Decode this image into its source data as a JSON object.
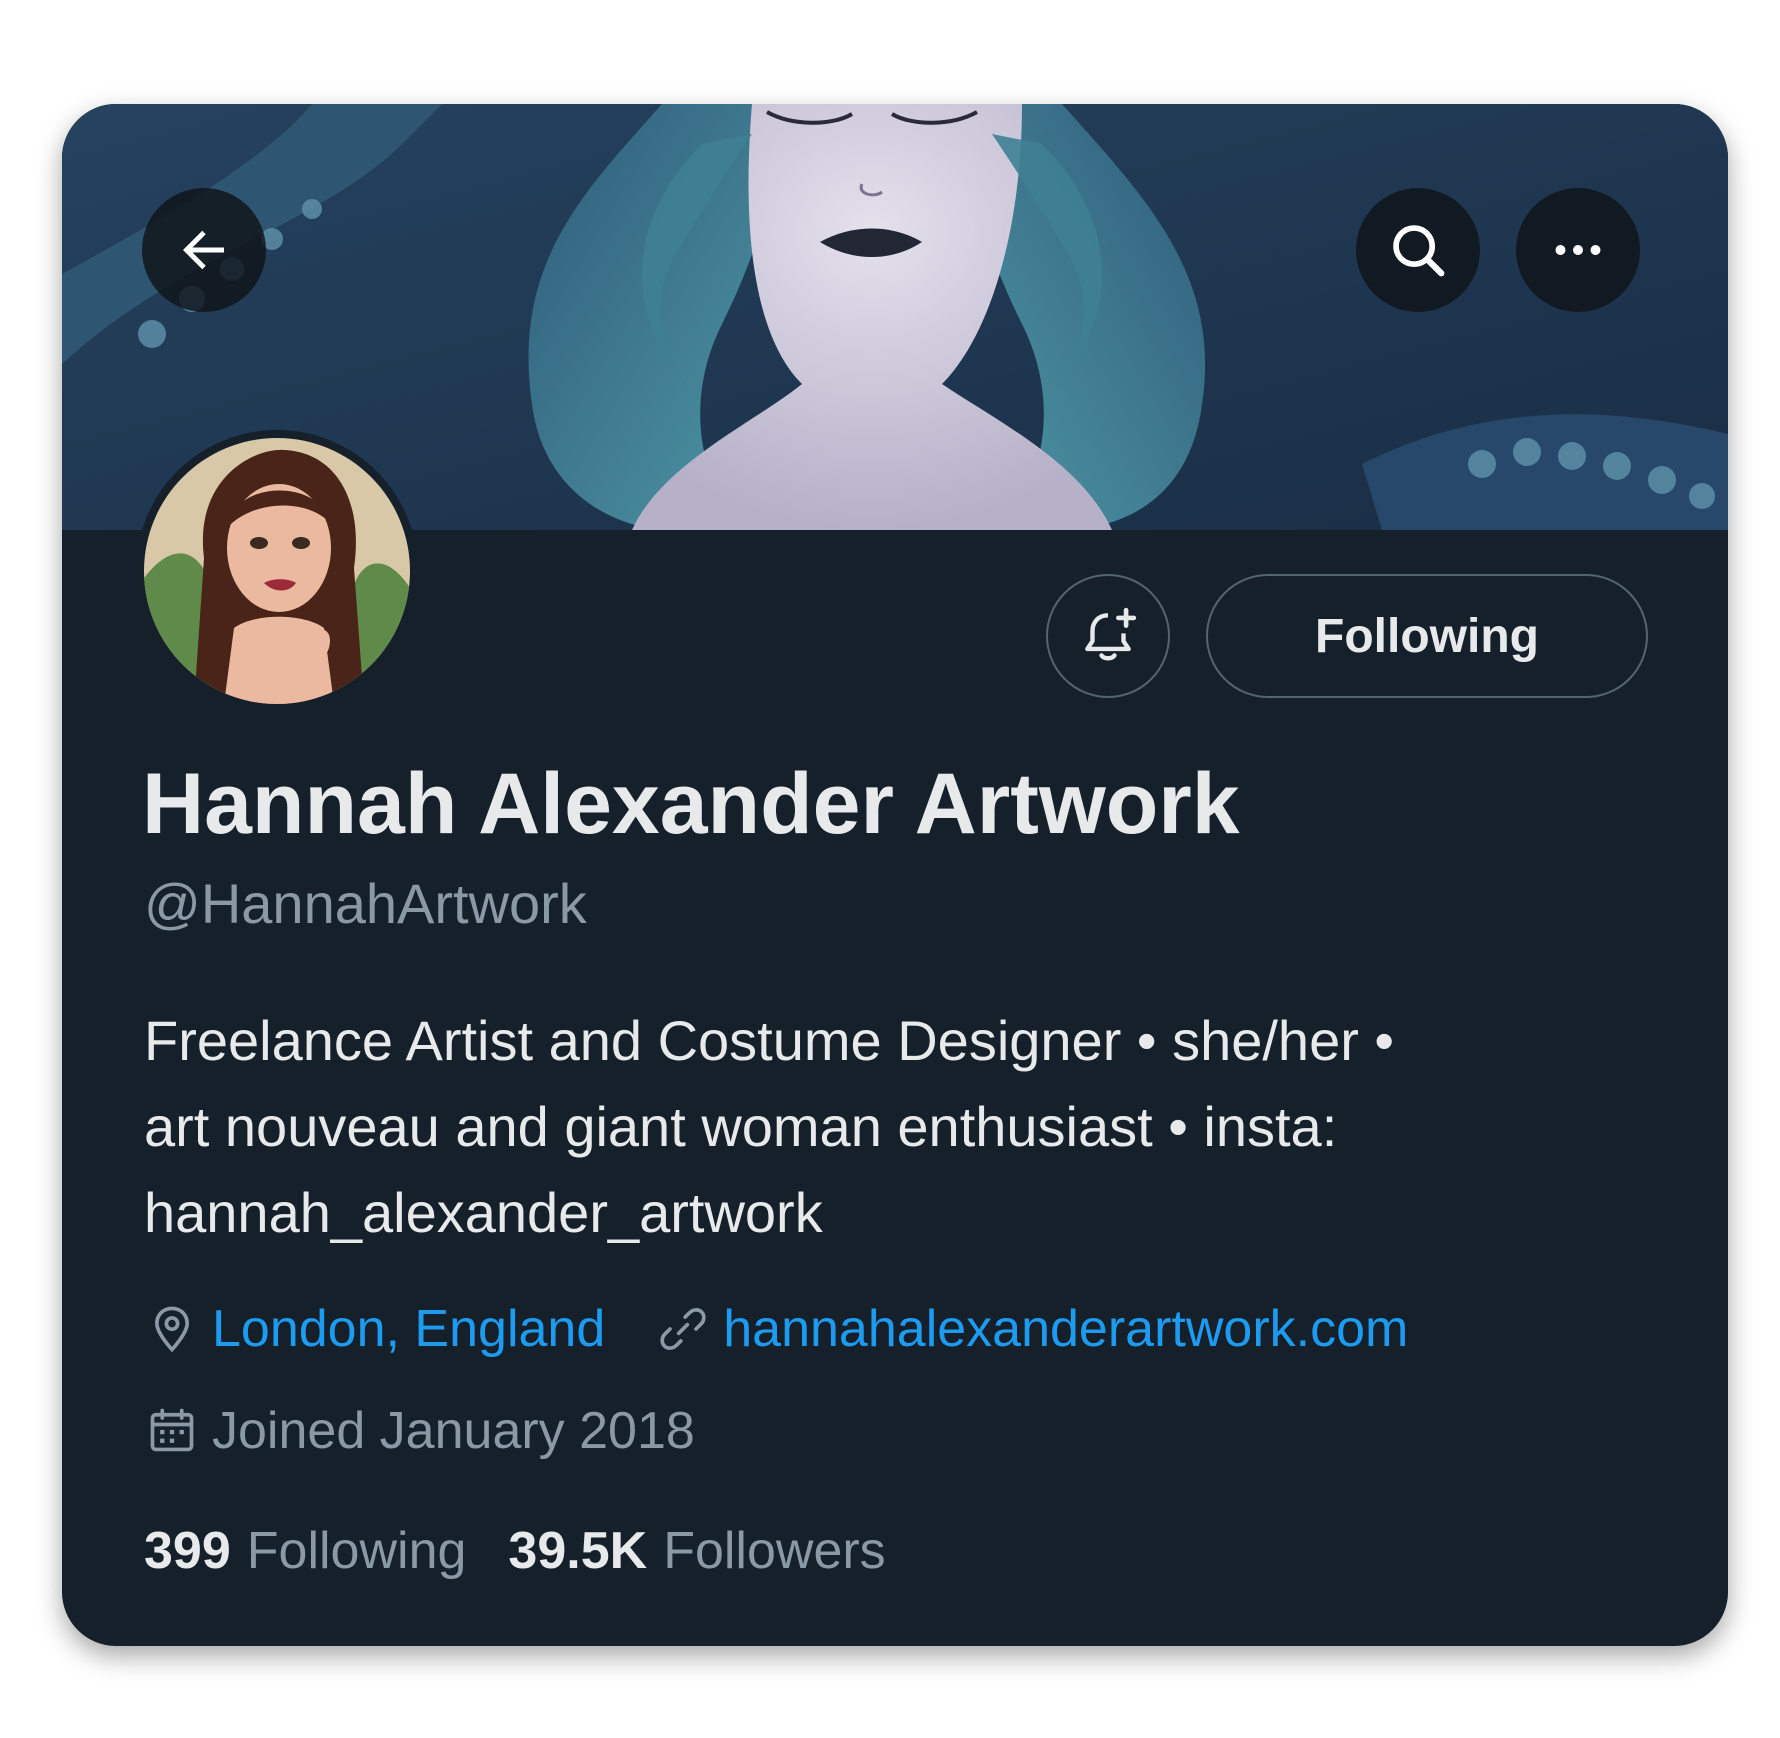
{
  "profile": {
    "display_name": "Hannah Alexander Artwork",
    "handle": "@HannahArtwork",
    "bio_lines": [
      "Freelance Artist and Costume Designer • she/her •",
      "art nouveau and giant woman enthusiast • insta:",
      "hannah_alexander_artwork"
    ],
    "location": "London, England",
    "website": "hannahalexanderartwork.com",
    "joined": "Joined January 2018"
  },
  "actions": {
    "following_label": "Following"
  },
  "stats": {
    "following_count": "399",
    "following_label": "Following",
    "followers_count": "39.5K",
    "followers_label": "Followers"
  },
  "icons": {
    "back": "back-arrow-icon",
    "search": "search-icon",
    "more": "more-icon",
    "notify": "bell-plus-icon",
    "location": "location-pin-icon",
    "link": "link-icon",
    "calendar": "calendar-icon"
  },
  "colors": {
    "background": "#15202b",
    "text_primary": "#e7e9ea",
    "text_secondary": "#8b98a5",
    "accent": "#1d9bf0",
    "border": "#536471"
  }
}
